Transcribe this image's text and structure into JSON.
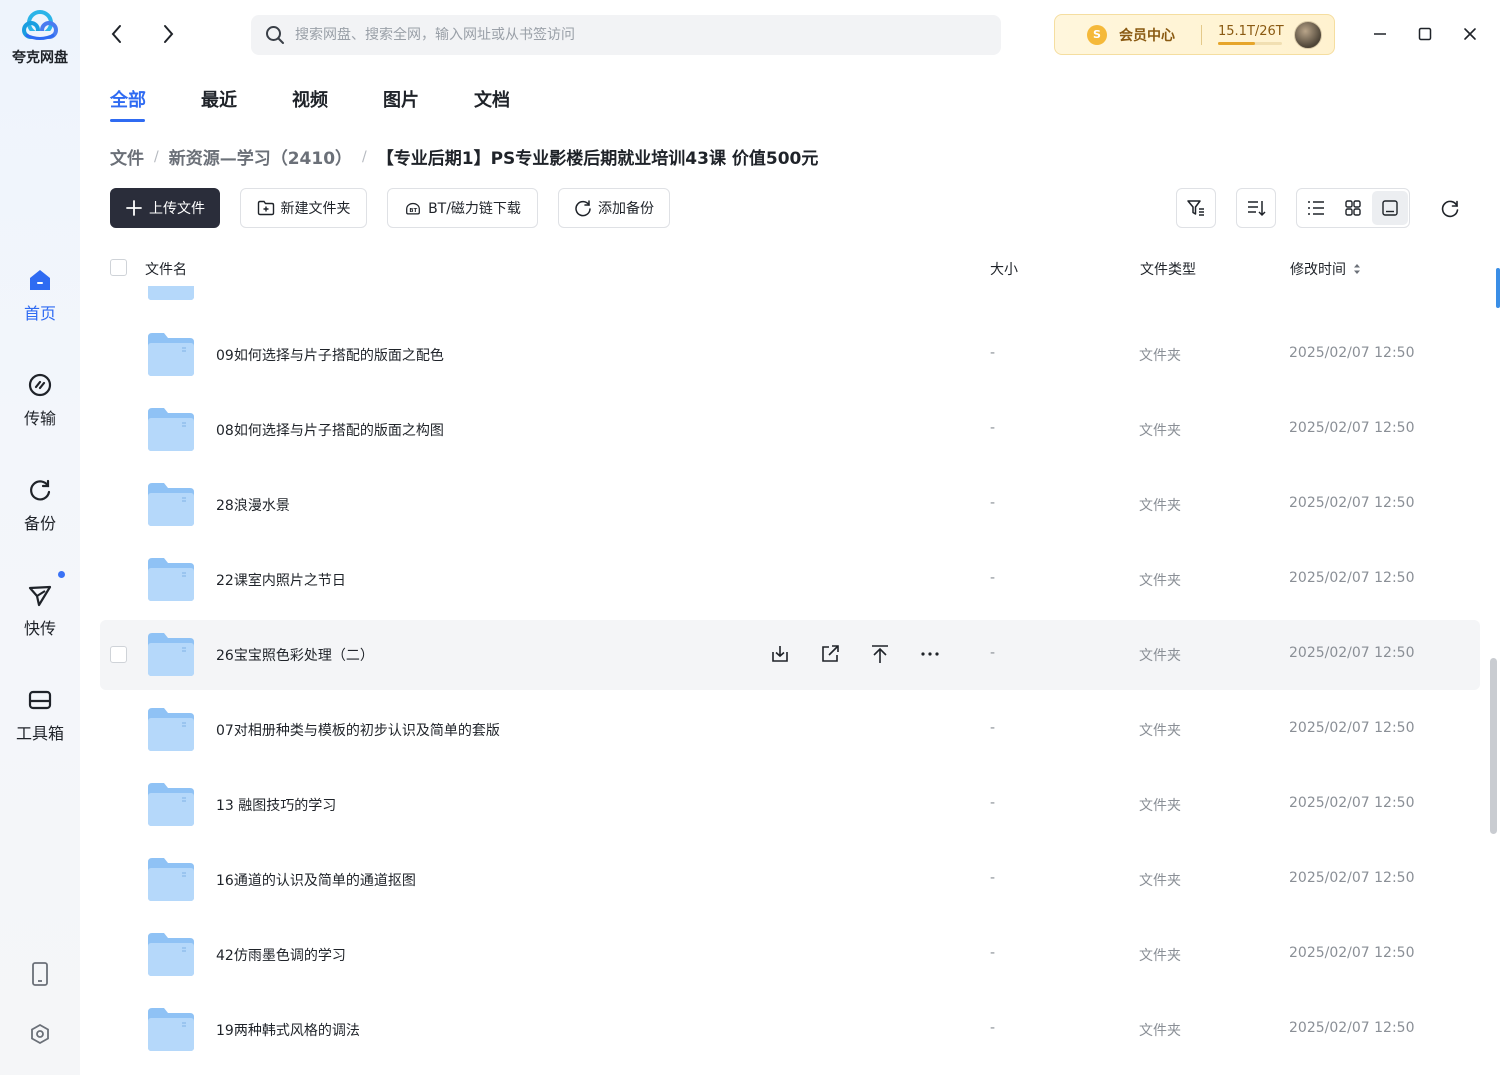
{
  "app": {
    "name": "夸克网盘"
  },
  "sidebar": {
    "items": [
      {
        "id": "home",
        "label": "首页",
        "icon": "home-icon",
        "active": true
      },
      {
        "id": "transfer",
        "label": "传输",
        "icon": "transfer-icon",
        "active": false
      },
      {
        "id": "backup",
        "label": "备份",
        "icon": "backup-icon",
        "active": false
      },
      {
        "id": "quick",
        "label": "快传",
        "icon": "send-icon",
        "active": false
      },
      {
        "id": "toolbox",
        "label": "工具箱",
        "icon": "toolbox-icon",
        "active": false
      }
    ],
    "bottom_icons": [
      "phone-icon",
      "settings-icon"
    ]
  },
  "topbar": {
    "search_placeholder": "搜索网盘、搜索全网，输入网址或从书签访问",
    "vip_label": "会员中心",
    "vip_coin": "S",
    "storage": "15.1T/26T",
    "storage_fraction": 0.58
  },
  "tabs": [
    {
      "label": "全部",
      "active": true
    },
    {
      "label": "最近",
      "active": false
    },
    {
      "label": "视频",
      "active": false
    },
    {
      "label": "图片",
      "active": false
    },
    {
      "label": "文档",
      "active": false
    }
  ],
  "breadcrumb": {
    "root": "文件",
    "parent": "新资源—学习（2410）",
    "current": "【专业后期1】PS专业影楼后期就业培训43课 价值500元"
  },
  "toolbar": {
    "upload": "上传文件",
    "new_folder": "新建文件夹",
    "bt": "BT/磁力链下载",
    "add_backup": "添加备份"
  },
  "table": {
    "headers": {
      "name": "文件名",
      "size": "大小",
      "type": "文件类型",
      "modified": "修改时间"
    },
    "rows": [
      {
        "name": "09如何选择与片子搭配的版面之配色",
        "size": "-",
        "type": "文件夹",
        "modified": "2025/02/07 12:50"
      },
      {
        "name": "08如何选择与片子搭配的版面之构图",
        "size": "-",
        "type": "文件夹",
        "modified": "2025/02/07 12:50"
      },
      {
        "name": "28浪漫水景",
        "size": "-",
        "type": "文件夹",
        "modified": "2025/02/07 12:50"
      },
      {
        "name": "22课室内照片之节日",
        "size": "-",
        "type": "文件夹",
        "modified": "2025/02/07 12:50"
      },
      {
        "name": "26宝宝照色彩处理（二）",
        "size": "-",
        "type": "文件夹",
        "modified": "2025/02/07 12:50",
        "hover": true
      },
      {
        "name": "07对相册种类与模板的初步认识及简单的套版",
        "size": "-",
        "type": "文件夹",
        "modified": "2025/02/07 12:50"
      },
      {
        "name": "13 融图技巧的学习",
        "size": "-",
        "type": "文件夹",
        "modified": "2025/02/07 12:50"
      },
      {
        "name": "16通道的认识及简单的通道抠图",
        "size": "-",
        "type": "文件夹",
        "modified": "2025/02/07 12:50"
      },
      {
        "name": "42仿雨墨色调的学习",
        "size": "-",
        "type": "文件夹",
        "modified": "2025/02/07 12:50"
      },
      {
        "name": "19两种韩式风格的调法",
        "size": "-",
        "type": "文件夹",
        "modified": "2025/02/07 12:50"
      }
    ]
  },
  "colors": {
    "accent": "#2f6bf2",
    "folder": "#8fc2f5",
    "primary_button": "#2a2d3a",
    "vip_text": "#8a5a12"
  }
}
